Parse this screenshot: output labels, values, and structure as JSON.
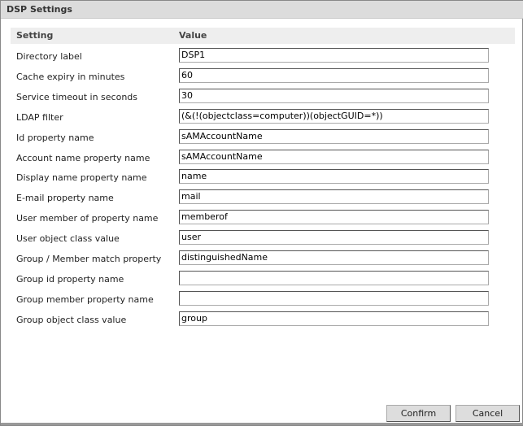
{
  "dialog": {
    "title": "DSP Settings"
  },
  "table": {
    "headers": {
      "setting": "Setting",
      "value": "Value"
    },
    "rows": [
      {
        "label": "Directory label",
        "value": "DSP1"
      },
      {
        "label": "Cache expiry in minutes",
        "value": "60"
      },
      {
        "label": "Service timeout in seconds",
        "value": "30"
      },
      {
        "label": "LDAP filter",
        "value": "(&(!(objectclass=computer))(objectGUID=*))"
      },
      {
        "label": "Id property name",
        "value": "sAMAccountName"
      },
      {
        "label": "Account name property name",
        "value": "sAMAccountName"
      },
      {
        "label": "Display name property name",
        "value": "name"
      },
      {
        "label": "E-mail property name",
        "value": "mail"
      },
      {
        "label": "User member of property name",
        "value": "memberof"
      },
      {
        "label": "User object class value",
        "value": "user"
      },
      {
        "label": "Group / Member match property",
        "value": "distinguishedName"
      },
      {
        "label": "Group id property name",
        "value": ""
      },
      {
        "label": "Group member property name",
        "value": ""
      },
      {
        "label": "Group object class value",
        "value": "group"
      }
    ]
  },
  "buttons": {
    "confirm": "Confirm",
    "cancel": "Cancel"
  }
}
